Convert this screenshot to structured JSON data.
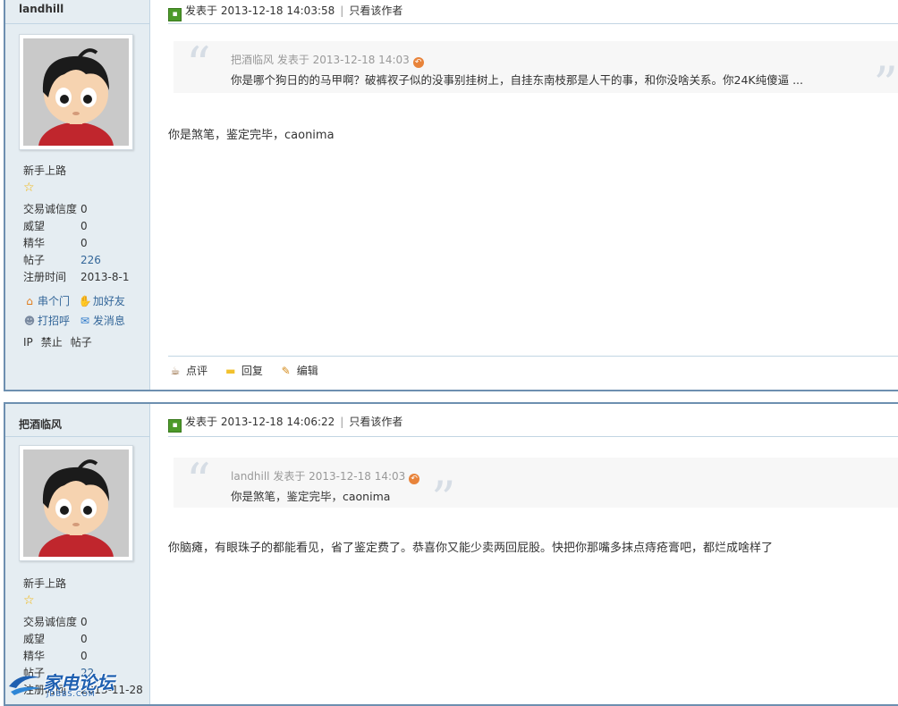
{
  "posts": [
    {
      "username": "landhill",
      "rank": "新手上路",
      "stats": [
        {
          "label": "交易诚信度",
          "value": "0"
        },
        {
          "label": "威望",
          "value": "0"
        },
        {
          "label": "精华",
          "value": "0"
        },
        {
          "label": "帖子",
          "value": "226"
        },
        {
          "label": "注册时间",
          "value": "2013-8-1"
        }
      ],
      "actions": {
        "visit": "串个门",
        "add_friend": "加好友",
        "greet": "打招呼",
        "message": "发消息",
        "ip": "IP",
        "ban": "禁止",
        "posts": "帖子"
      },
      "header": {
        "published": "发表于 2013-12-18 14:03:58",
        "author_only": "只看该作者"
      },
      "quote": {
        "meta": "把酒临风 发表于 2013-12-18 14:03",
        "text": "你是哪个狗日的的马甲啊？破裤衩子似的没事别挂树上，自挂东南枝那是人干的事，和你没啥关系。你24K纯傻逼 ..."
      },
      "message": "你是煞笔，鉴定完毕，caonima",
      "footer": {
        "rate": "点评",
        "reply": "回复",
        "edit": "编辑"
      }
    },
    {
      "username": "把酒临风",
      "rank": "新手上路",
      "stats": [
        {
          "label": "交易诚信度",
          "value": "0"
        },
        {
          "label": "威望",
          "value": "0"
        },
        {
          "label": "精华",
          "value": "0"
        },
        {
          "label": "帖子",
          "value": "22"
        },
        {
          "label": "注册时间",
          "value": "2013-11-28"
        }
      ],
      "header": {
        "published": "发表于 2013-12-18 14:06:22",
        "author_only": "只看该作者"
      },
      "quote": {
        "meta": "landhill 发表于 2013-12-18 14:03",
        "text": "你是煞笔，鉴定完毕，caonima"
      },
      "message": "你脑瘫，有眼珠子的都能看见，省了鉴定费了。恭喜你又能少卖两回屁股。快把你那嘴多抹点痔疮膏吧，都烂成啥样了"
    }
  ],
  "watermark": {
    "text": "家电论坛",
    "sub": "JDBBS.COM"
  },
  "colors": {
    "border": "#6d8fb0",
    "sidebar_bg": "#e5edf2",
    "link": "#336699",
    "quote_bg": "#f7f7f7"
  }
}
